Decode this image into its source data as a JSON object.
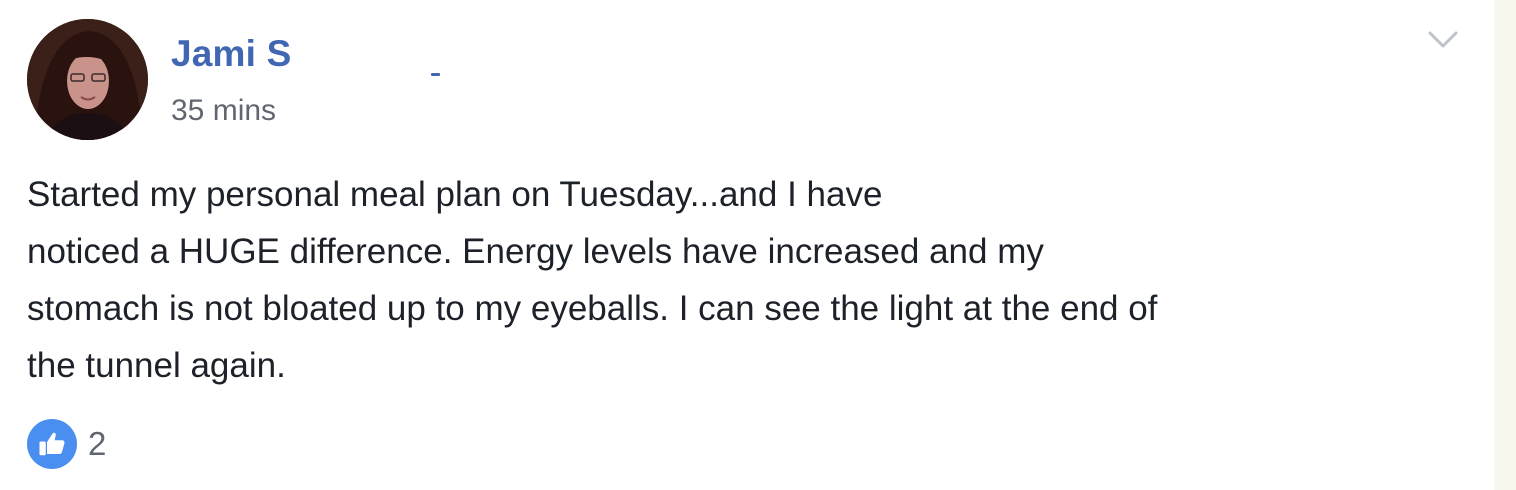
{
  "post": {
    "author": "Jami S",
    "timestamp": "35 mins",
    "body_lines": [
      "Started my personal meal plan on Tuesday...and I have",
      "noticed a HUGE difference. Energy levels have increased and my",
      "stomach is not bloated up to my eyeballs. I can see the light at the end of",
      "the tunnel again."
    ],
    "reactions": {
      "icon": "thumbs-up-icon",
      "count": "2"
    },
    "options_icon": "chevron-down-icon"
  },
  "colors": {
    "author_link": "#4267b2",
    "meta_text": "#616770",
    "body_text": "#1d2129",
    "like_badge": "#4a8ff0"
  }
}
